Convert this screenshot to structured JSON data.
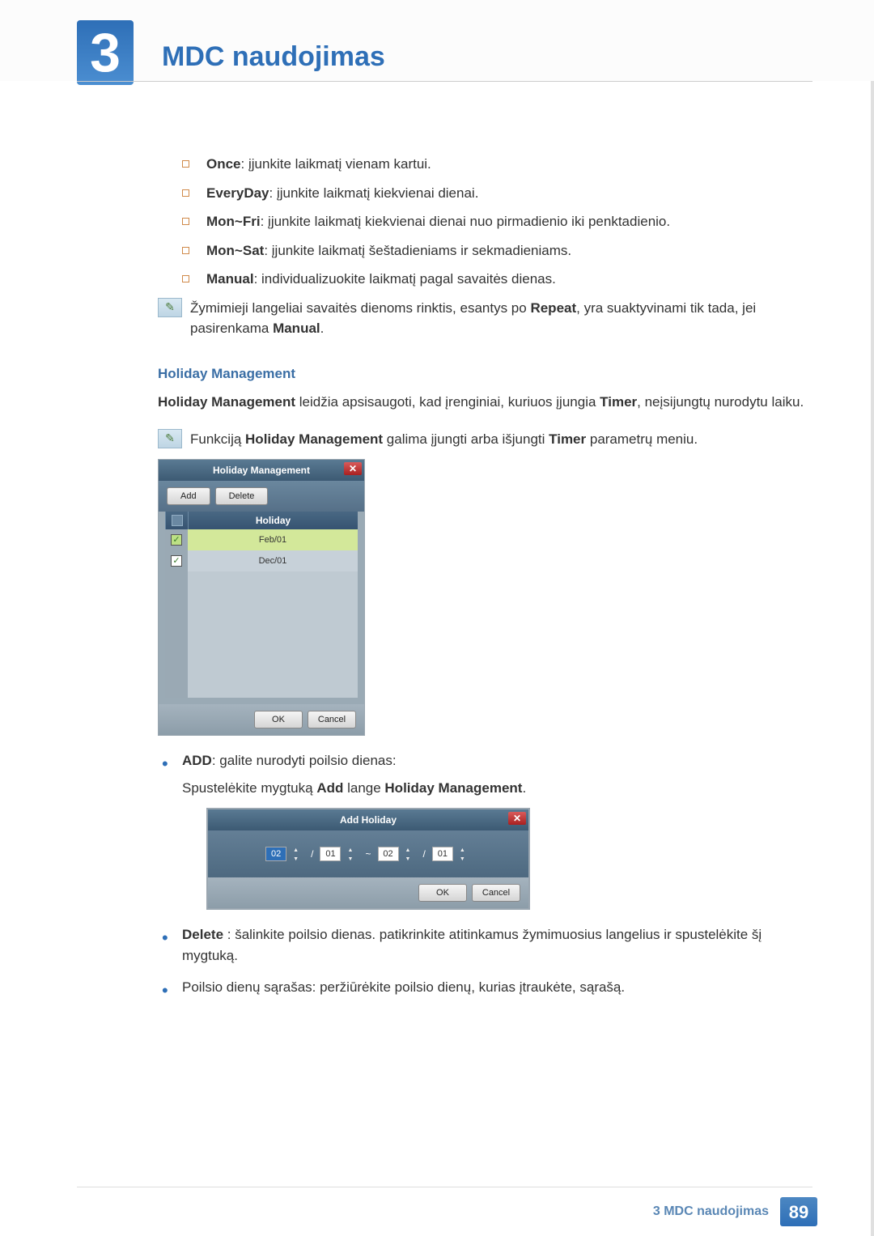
{
  "header": {
    "chapter_number": "3",
    "chapter_title": "MDC naudojimas"
  },
  "options": [
    {
      "bold": "Once",
      "text": ": įjunkite laikmatį vienam kartui."
    },
    {
      "bold": "EveryDay",
      "text": ": įjunkite laikmatį kiekvienai dienai."
    },
    {
      "bold": "Mon~Fri",
      "text": ": įjunkite laikmatį kiekvienai dienai nuo pirmadienio iki penktadienio."
    },
    {
      "bold": "Mon~Sat",
      "text": ": įjunkite laikmatį šeštadieniams ir sekmadieniams."
    },
    {
      "bold": "Manual",
      "text": ": individualizuokite laikmatį pagal savaitės dienas."
    }
  ],
  "note1_a": "Žymimieji langeliai savaitės dienoms rinktis, esantys po ",
  "note1_b": "Repeat",
  "note1_c": ", yra suaktyvinami tik tada, jei pasirenkama ",
  "note1_d": "Manual",
  "note1_e": ".",
  "holiday_heading": "Holiday Management",
  "hm_sent_b1": "Holiday Management",
  "hm_sent_mid": " leidžia apsisaugoti, kad įrenginiai, kuriuos įjungia ",
  "hm_sent_b2": "Timer",
  "hm_sent_end": ", neįsijungtų nurodytu laiku.",
  "note2_a": "Funkciją ",
  "note2_b": "Holiday Management",
  "note2_c": " galima įjungti arba išjungti ",
  "note2_d": "Timer",
  "note2_e": " parametrų meniu.",
  "dialog1": {
    "title": "Holiday Management",
    "add": "Add",
    "delete": "Delete",
    "col_holiday": "Holiday",
    "rows": [
      "Feb/01",
      "Dec/01"
    ],
    "ok": "OK",
    "cancel": "Cancel"
  },
  "add_item_b": "ADD",
  "add_item_t": ": galite nurodyti poilsio dienas:",
  "add_sub_a": "Spustelėkite mygtuką ",
  "add_sub_b": "Add",
  "add_sub_c": " lange ",
  "add_sub_d": "Holiday Management",
  "add_sub_e": ".",
  "dialog2": {
    "title": "Add Holiday",
    "v1": "02",
    "v2": "01",
    "v3": "02",
    "v4": "01",
    "slash": "/",
    "tilde": "~",
    "ok": "OK",
    "cancel": "Cancel"
  },
  "del_item_b": "Delete",
  "del_item_t": " : šalinkite poilsio dienas. patikrinkite atitinkamus žymimuosius langelius ir spustelėkite šį mygtuką.",
  "list_item": "Poilsio dienų sąrašas: peržiūrėkite poilsio dienų, kurias įtraukėte, sąrašą.",
  "footer": {
    "text": "3 MDC naudojimas",
    "page": "89"
  }
}
